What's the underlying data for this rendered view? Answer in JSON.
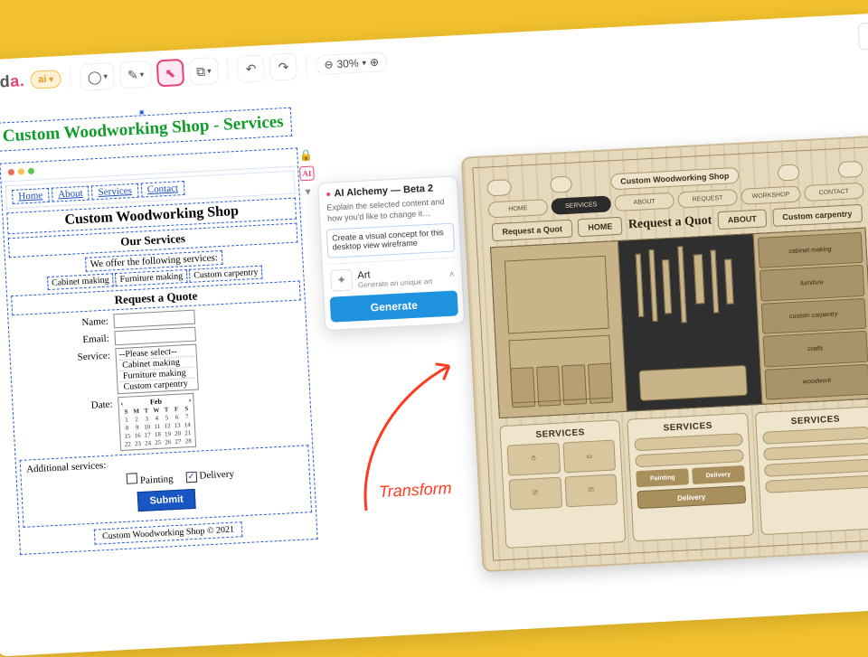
{
  "brand": {
    "part1": "Jed",
    "part2": "a",
    "dot": "."
  },
  "ai_pill": {
    "label": "ai"
  },
  "toolbar": {
    "zoom_value": "30%"
  },
  "wireframe": {
    "page_title": "Custom Woodworking Shop - Services",
    "nav": [
      "Home",
      "About",
      "Services",
      "Contact"
    ],
    "h2": "Custom Woodworking Shop",
    "h3_services": "Our Services",
    "services_intro": "We offer the following services:",
    "service_chips": [
      "Cabinet making",
      "Furniture making",
      "Custom carpentry"
    ],
    "h3_quote": "Request a Quote",
    "form": {
      "name_label": "Name:",
      "email_label": "Email:",
      "service_label": "Service:",
      "service_placeholder": "--Please select--",
      "service_options": [
        "Cabinet making",
        "Furniture making",
        "Custom carpentry"
      ],
      "date_label": "Date:",
      "cal_month": "Feb",
      "cal_prev": "‹",
      "cal_next": "›",
      "cal_days": [
        "S",
        "M",
        "T",
        "W",
        "T",
        "F",
        "S"
      ],
      "additional_label": "Additional services:",
      "check_painting": "Painting",
      "check_delivery": "Delivery",
      "submit": "Submit"
    },
    "footer": "Custom Woodworking Shop © 2021"
  },
  "popup": {
    "title": "AI Alchemy — Beta 2",
    "subtitle": "Explain the selected content and how you'd like to change it…",
    "input_value": "Create a visual concept for this desktop view wireframe",
    "mode_title": "Art",
    "mode_sub": "Generate an unique art",
    "button": "Generate"
  },
  "transform_label": "Transform",
  "preview": {
    "logo_text": "Custom Woodworking Shop",
    "top_pills": [
      "",
      "",
      "",
      "",
      "",
      ""
    ],
    "mid_tabs": [
      "HOME",
      "SERVICES",
      "ABOUT",
      "REQUEST",
      "WORKSHOP",
      "CONTACT"
    ],
    "banner_left_pill": "Request a Quot",
    "banner_home": "HOME",
    "banner_center": "Request a Quot",
    "banner_about": "ABOUT",
    "banner_right_pill": "Custom carpentry",
    "shelf_tags": [
      "cabinet making",
      "furniture",
      "custom carpentry",
      "crafts",
      "woodwork"
    ],
    "card1": {
      "title": "SERVICES"
    },
    "card2": {
      "title": "SERVICES",
      "mini": [
        "Painting",
        "Delivery"
      ],
      "btn": "Delivery"
    },
    "card3": {
      "title": "SERVICES"
    }
  }
}
